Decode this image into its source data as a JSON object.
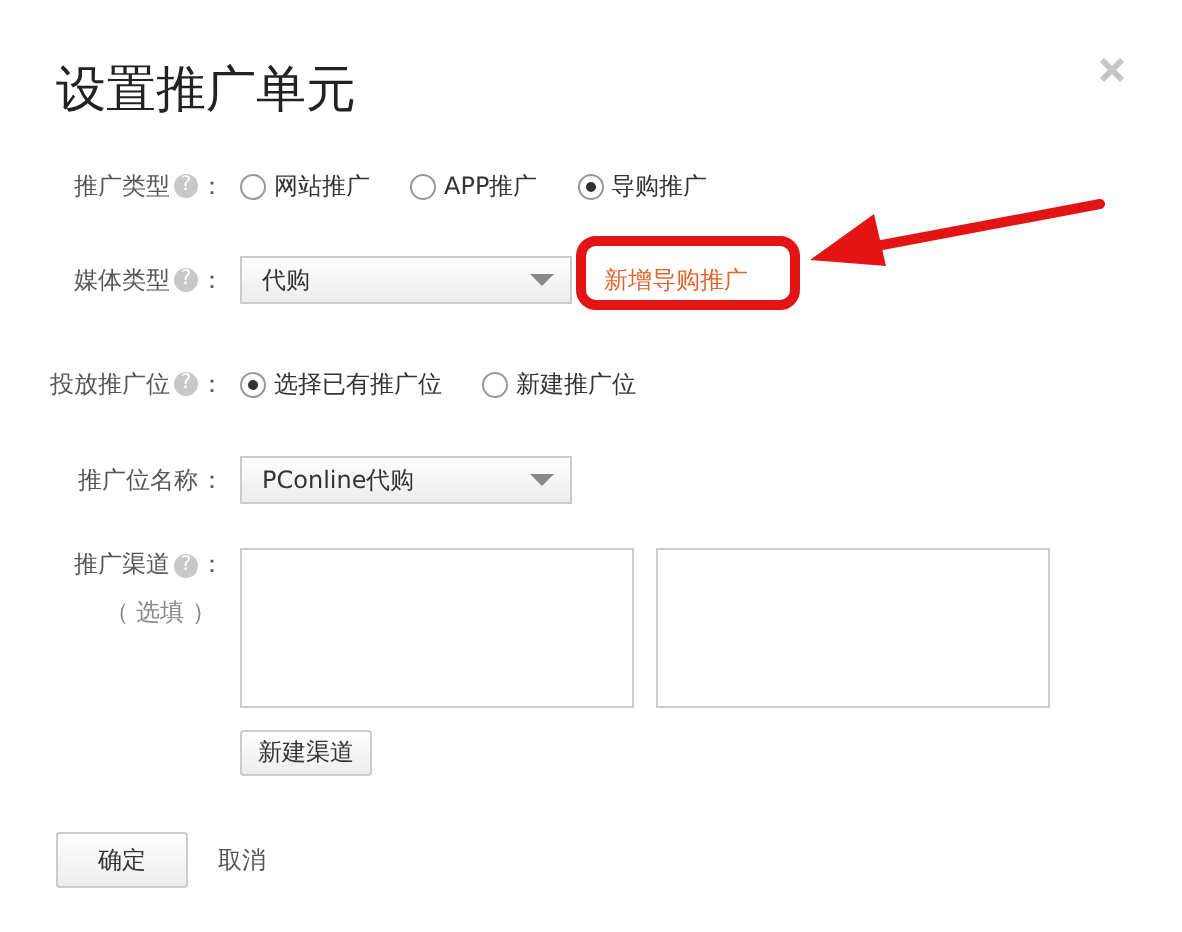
{
  "dialog": {
    "title": "设置推广单元"
  },
  "fields": [
    {
      "kind": "radio",
      "label": "推广类型",
      "help": "?",
      "colon": "：",
      "options": [
        {
          "label": "网站推广",
          "selected": false
        },
        {
          "label": "APP推广",
          "selected": false
        },
        {
          "label": "导购推广",
          "selected": true
        }
      ]
    },
    {
      "kind": "select",
      "label": "媒体类型",
      "help": "?",
      "colon": "：",
      "value": "代购",
      "link": {
        "label": "新增导购推广",
        "highlighted": true
      }
    },
    {
      "kind": "radio",
      "label": "投放推广位",
      "help": "?",
      "colon": "：",
      "options": [
        {
          "label": "选择已有推广位",
          "selected": true
        },
        {
          "label": "新建推广位",
          "selected": false
        }
      ]
    },
    {
      "kind": "select",
      "label": "推广位名称",
      "colon": "：",
      "value": "PConline代购"
    },
    {
      "kind": "lists",
      "label": "推广渠道",
      "help": "?",
      "colon": "：",
      "note": "（ 选填 ）",
      "areas": [
        {
          "kind": "listbox"
        },
        {
          "kind": "listbox"
        }
      ],
      "button": "新建渠道"
    }
  ],
  "footer": [
    {
      "kind": "button",
      "label": "确定"
    },
    {
      "kind": "link",
      "label": "取消"
    }
  ]
}
